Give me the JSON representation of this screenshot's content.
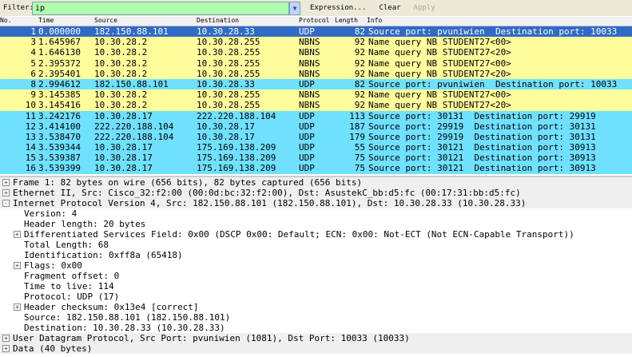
{
  "filter": {
    "label": "Filter:",
    "value": "ip",
    "expression": "Expression...",
    "clear": "Clear",
    "apply": "Apply"
  },
  "columns": {
    "no": "No.",
    "time": "Time",
    "source": "Source",
    "destination": "Destination",
    "protocol": "Protocol",
    "length": "Length",
    "info": "Info"
  },
  "colors": {
    "selected": "#316ac5",
    "nbns": "#fffc9c",
    "udp": "#70e0ff"
  },
  "packets": [
    {
      "no": "1",
      "time": "0.000000",
      "src": "182.150.88.101",
      "dst": "10.30.28.33",
      "proto": "UDP",
      "len": "82",
      "info": "Source port: pvuniwien  Destination port: 10033",
      "kind": "selected"
    },
    {
      "no": "3",
      "time": "1.645967",
      "src": "10.30.28.2",
      "dst": "10.30.28.255",
      "proto": "NBNS",
      "len": "92",
      "info": "Name query NB STUDENT27<00>",
      "kind": "nbns"
    },
    {
      "no": "4",
      "time": "1.646130",
      "src": "10.30.28.2",
      "dst": "10.30.28.255",
      "proto": "NBNS",
      "len": "92",
      "info": "Name query NB STUDENT27<20>",
      "kind": "nbns"
    },
    {
      "no": "5",
      "time": "2.395372",
      "src": "10.30.28.2",
      "dst": "10.30.28.255",
      "proto": "NBNS",
      "len": "92",
      "info": "Name query NB STUDENT27<00>",
      "kind": "nbns"
    },
    {
      "no": "6",
      "time": "2.395401",
      "src": "10.30.28.2",
      "dst": "10.30.28.255",
      "proto": "NBNS",
      "len": "92",
      "info": "Name query NB STUDENT27<20>",
      "kind": "nbns"
    },
    {
      "no": "8",
      "time": "2.994612",
      "src": "182.150.88.101",
      "dst": "10.30.28.33",
      "proto": "UDP",
      "len": "82",
      "info": "Source port: pvuniwien  Destination port: 10033",
      "kind": "udp"
    },
    {
      "no": "9",
      "time": "3.145385",
      "src": "10.30.28.2",
      "dst": "10.30.28.255",
      "proto": "NBNS",
      "len": "92",
      "info": "Name query NB STUDENT27<00>",
      "kind": "nbns"
    },
    {
      "no": "10",
      "time": "3.145416",
      "src": "10.30.28.2",
      "dst": "10.30.28.255",
      "proto": "NBNS",
      "len": "92",
      "info": "Name query NB STUDENT27<20>",
      "kind": "nbns"
    },
    {
      "no": "11",
      "time": "3.242176",
      "src": "10.30.28.17",
      "dst": "222.220.188.104",
      "proto": "UDP",
      "len": "113",
      "info": "Source port: 30131  Destination port: 29919",
      "kind": "udp"
    },
    {
      "no": "12",
      "time": "3.414100",
      "src": "222.220.188.104",
      "dst": "10.30.28.17",
      "proto": "UDP",
      "len": "187",
      "info": "Source port: 29919  Destination port: 30131",
      "kind": "udp"
    },
    {
      "no": "13",
      "time": "3.538470",
      "src": "222.220.188.104",
      "dst": "10.30.28.17",
      "proto": "UDP",
      "len": "179",
      "info": "Source port: 29919  Destination port: 30131",
      "kind": "udp"
    },
    {
      "no": "14",
      "time": "3.539344",
      "src": "10.30.28.17",
      "dst": "175.169.138.209",
      "proto": "UDP",
      "len": "55",
      "info": "Source port: 30121  Destination port: 30913",
      "kind": "udp"
    },
    {
      "no": "15",
      "time": "3.539387",
      "src": "10.30.28.17",
      "dst": "175.169.138.209",
      "proto": "UDP",
      "len": "75",
      "info": "Source port: 30121  Destination port: 30913",
      "kind": "udp"
    },
    {
      "no": "16",
      "time": "3.539399",
      "src": "10.30.28.17",
      "dst": "175.169.138.209",
      "proto": "UDP",
      "len": "75",
      "info": "Source port: 30121  Destination port: 30913",
      "kind": "udp"
    }
  ],
  "details": [
    {
      "text": "Frame 1: 82 bytes on wire (656 bits), 82 bytes captured (656 bits)",
      "level": "top",
      "exp": "+"
    },
    {
      "text": "Ethernet II, Src: Cisco_32:f2:00 (00:0d:bc:32:f2:00), Dst: AsustekC_bb:d5:fc (00:17:31:bb:d5:fc)",
      "level": "top",
      "exp": "+"
    },
    {
      "text": "Internet Protocol Version 4, Src: 182.150.88.101 (182.150.88.101), Dst: 10.30.28.33 (10.30.28.33)",
      "level": "top",
      "exp": "-"
    },
    {
      "text": "Version: 4",
      "level": "l1",
      "exp": ""
    },
    {
      "text": "Header length: 20 bytes",
      "level": "l1",
      "exp": ""
    },
    {
      "text": "Differentiated Services Field: 0x00 (DSCP 0x00: Default; ECN: 0x00: Not-ECT (Not ECN-Capable Transport))",
      "level": "l1",
      "exp": "+"
    },
    {
      "text": "Total Length: 68",
      "level": "l1",
      "exp": ""
    },
    {
      "text": "Identification: 0xff8a (65418)",
      "level": "l1",
      "exp": ""
    },
    {
      "text": "Flags: 0x00",
      "level": "l1",
      "exp": "+"
    },
    {
      "text": "Fragment offset: 0",
      "level": "l1",
      "exp": ""
    },
    {
      "text": "Time to live: 114",
      "level": "l1",
      "exp": ""
    },
    {
      "text": "Protocol: UDP (17)",
      "level": "l1",
      "exp": ""
    },
    {
      "text": "Header checksum: 0x13e4 [correct]",
      "level": "l1",
      "exp": "+"
    },
    {
      "text": "Source: 182.150.88.101 (182.150.88.101)",
      "level": "l1",
      "exp": ""
    },
    {
      "text": "Destination: 10.30.28.33 (10.30.28.33)",
      "level": "l1",
      "exp": ""
    },
    {
      "text": "User Datagram Protocol, Src Port: pvuniwien (1081), Dst Port: 10033 (10033)",
      "level": "top",
      "exp": "+"
    },
    {
      "text": "Data (40 bytes)",
      "level": "top",
      "exp": "+"
    }
  ]
}
